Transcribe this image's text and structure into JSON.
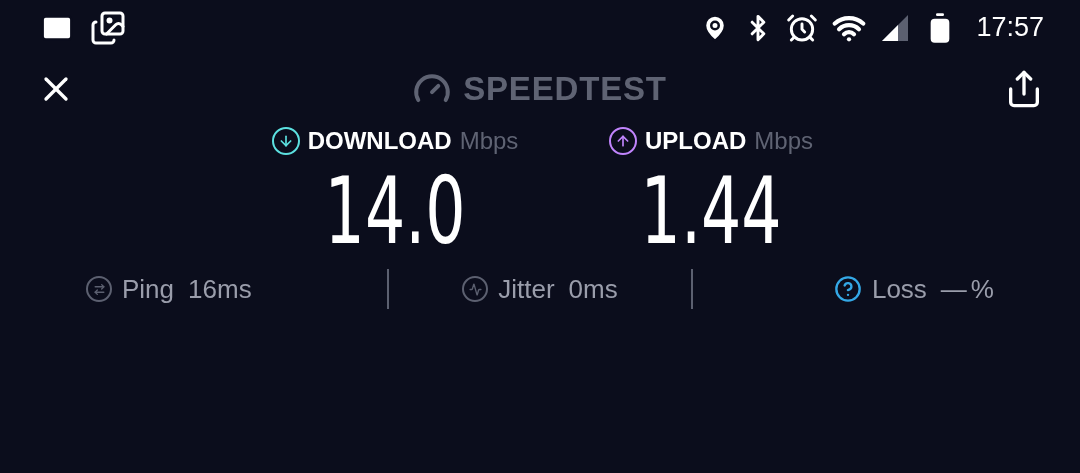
{
  "status_bar": {
    "time": "17:57"
  },
  "header": {
    "title": "SPEEDTEST"
  },
  "results": [
    {
      "kind": "download",
      "label": "DOWNLOAD",
      "unit": "Mbps",
      "value": "14.0",
      "color": "#5ce0e0"
    },
    {
      "kind": "upload",
      "label": "UPLOAD",
      "unit": "Mbps",
      "value": "1.44",
      "color": "#c084fc"
    }
  ],
  "stats": [
    {
      "kind": "ping",
      "label": "Ping",
      "value": "16ms"
    },
    {
      "kind": "jitter",
      "label": "Jitter",
      "value": "0ms"
    },
    {
      "kind": "loss",
      "label": "Loss",
      "value": "—",
      "unit": "%"
    }
  ]
}
